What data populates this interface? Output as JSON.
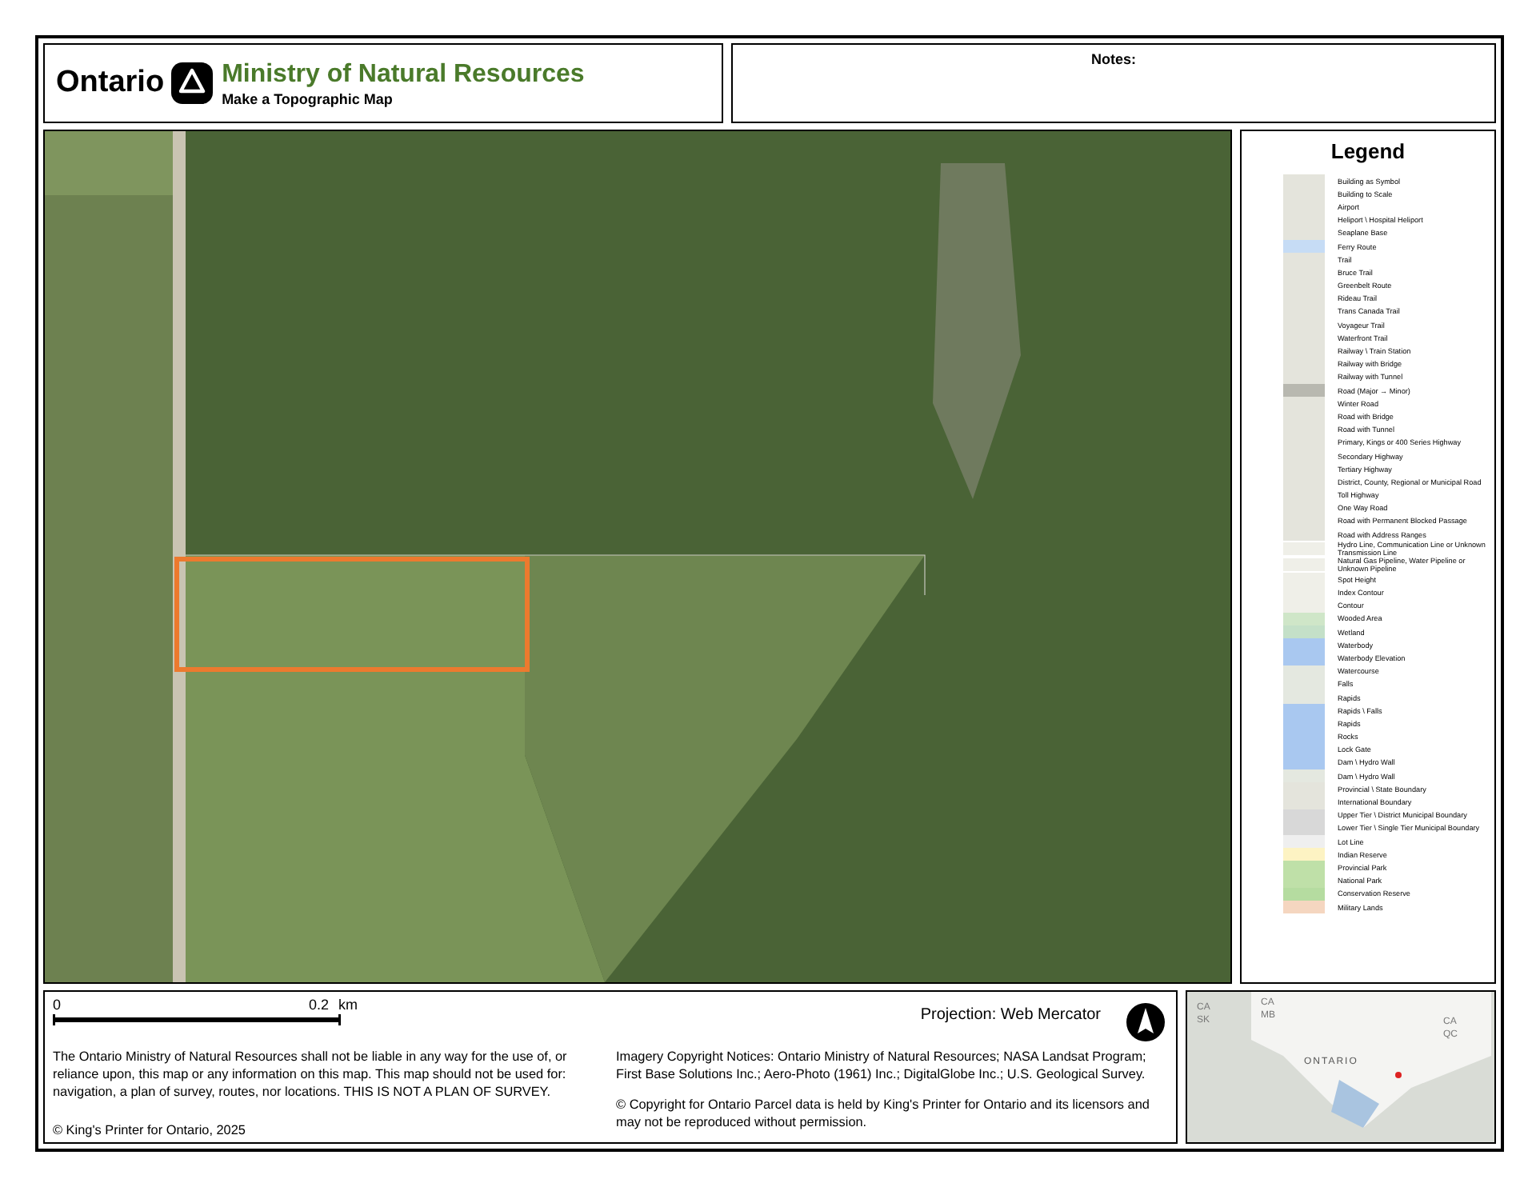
{
  "header": {
    "brand": "Ontario",
    "title": "Ministry of Natural Resources",
    "subtitle": "Make a Topographic Map",
    "notes_label": "Notes:"
  },
  "legend": {
    "title": "Legend",
    "items": [
      {
        "label": "Building as Symbol",
        "color": "#e4e4dc"
      },
      {
        "label": "Building to Scale",
        "color": "#e4e4dc"
      },
      {
        "label": "Airport",
        "color": "#e4e4dc"
      },
      {
        "label": "Heliport \\ Hospital Heliport",
        "color": "#e4e4dc"
      },
      {
        "label": "Seaplane Base",
        "color": "#e4e4dc"
      },
      {
        "label": "Ferry Route",
        "color": "#c6dcf5"
      },
      {
        "label": "Trail",
        "color": "#e4e4dc"
      },
      {
        "label": "Bruce Trail",
        "color": "#e4e4dc"
      },
      {
        "label": "Greenbelt Route",
        "color": "#e4e4dc"
      },
      {
        "label": "Rideau Trail",
        "color": "#e4e4dc"
      },
      {
        "label": "Trans Canada Trail",
        "color": "#e4e4dc"
      },
      {
        "label": "Voyageur Trail",
        "color": "#e4e4dc"
      },
      {
        "label": "Waterfront Trail",
        "color": "#e4e4dc"
      },
      {
        "label": "Railway \\ Train Station",
        "color": "#e4e4dc"
      },
      {
        "label": "Railway with Bridge",
        "color": "#e4e4dc"
      },
      {
        "label": "Railway with Tunnel",
        "color": "#e4e4dc"
      },
      {
        "label": "Road (Major → Minor)",
        "color": "#b8b8b0"
      },
      {
        "label": "Winter Road",
        "color": "#e4e4dc"
      },
      {
        "label": "Road with Bridge",
        "color": "#e4e4dc"
      },
      {
        "label": "Road with Tunnel",
        "color": "#e4e4dc"
      },
      {
        "label": "Primary, Kings or 400 Series Highway",
        "color": "#e4e4dc"
      },
      {
        "label": "Secondary Highway",
        "color": "#e4e4dc"
      },
      {
        "label": "Tertiary Highway",
        "color": "#e4e4dc"
      },
      {
        "label": "District, County, Regional or Municipal Road",
        "color": "#e4e4dc"
      },
      {
        "label": "Toll Highway",
        "color": "#e4e4dc"
      },
      {
        "label": "One Way Road",
        "color": "#e4e4dc"
      },
      {
        "label": "Road with Permanent Blocked Passage",
        "color": "#e4e4dc"
      },
      {
        "label": "Road with Address Ranges",
        "color": "#e4e4dc"
      },
      {
        "label": "Hydro Line, Communication Line or Unknown Transmission Line",
        "color": "#efefe8"
      },
      {
        "label": "Natural Gas Pipeline, Water Pipeline or Unknown Pipeline",
        "color": "#efefe8"
      },
      {
        "label": "Spot Height",
        "color": "#efefe8"
      },
      {
        "label": "Index Contour",
        "color": "#efefe8"
      },
      {
        "label": "Contour",
        "color": "#efefe8"
      },
      {
        "label": "Wooded Area",
        "color": "#cfe6c8"
      },
      {
        "label": "Wetland",
        "color": "#c4e0c8"
      },
      {
        "label": "Waterbody",
        "color": "#a9c8f0"
      },
      {
        "label": "Waterbody Elevation",
        "color": "#a9c8f0"
      },
      {
        "label": "Watercourse",
        "color": "#e4e8e0"
      },
      {
        "label": "Falls",
        "color": "#e4e8e0"
      },
      {
        "label": "Rapids",
        "color": "#e4e8e0"
      },
      {
        "label": "Rapids \\ Falls",
        "color": "#a9c8f0"
      },
      {
        "label": "Rapids",
        "color": "#a9c8f0"
      },
      {
        "label": "Rocks",
        "color": "#a9c8f0"
      },
      {
        "label": "Lock Gate",
        "color": "#a9c8f0"
      },
      {
        "label": "Dam \\ Hydro Wall",
        "color": "#a9c8f0"
      },
      {
        "label": "Dam \\ Hydro Wall",
        "color": "#e4e8e0"
      },
      {
        "label": "Provincial \\ State Boundary",
        "color": "#e4e4dc"
      },
      {
        "label": "International Boundary",
        "color": "#e4e4dc"
      },
      {
        "label": "Upper Tier \\ District Municipal Boundary",
        "color": "#d8d8d8"
      },
      {
        "label": "Lower Tier \\ Single Tier Municipal Boundary",
        "color": "#d8d8d8"
      },
      {
        "label": "Lot Line",
        "color": "#efefef"
      },
      {
        "label": "Indian Reserve",
        "color": "#fdf3c3"
      },
      {
        "label": "Provincial Park",
        "color": "#bfe0a8"
      },
      {
        "label": "National Park",
        "color": "#bfe0a8"
      },
      {
        "label": "Conservation Reserve",
        "color": "#b5dca0"
      },
      {
        "label": "Military Lands",
        "color": "#f5d6c0"
      }
    ]
  },
  "scale_bar": {
    "start": "0",
    "end": "0.2",
    "unit": "km"
  },
  "projection": "Projection: Web Mercator",
  "disclaimer": "The Ontario Ministry of Natural Resources shall not be liable in any way for the use of, or reliance upon, this map or any information on this map.  This map should not be used for: navigation, a plan of survey, routes, nor locations. THIS IS NOT A PLAN OF SURVEY.",
  "copyright": "© King's Printer for Ontario,  2025",
  "imagery_notice": "Imagery Copyright Notices: Ontario Ministry of Natural Resources; NASA Landsat Program; First Base Solutions Inc.; Aero-Photo (1961) Inc.; DigitalGlobe Inc.; U.S. Geological Survey.",
  "parcel_notice": "© Copyright for Ontario Parcel data is held by King's Printer for Ontario and its licensors and may not be reproduced without permission.",
  "inset_map": {
    "labels": [
      "CA",
      "SK",
      "CA",
      "MB",
      "CA",
      "QC",
      "ONTARIO"
    ]
  }
}
